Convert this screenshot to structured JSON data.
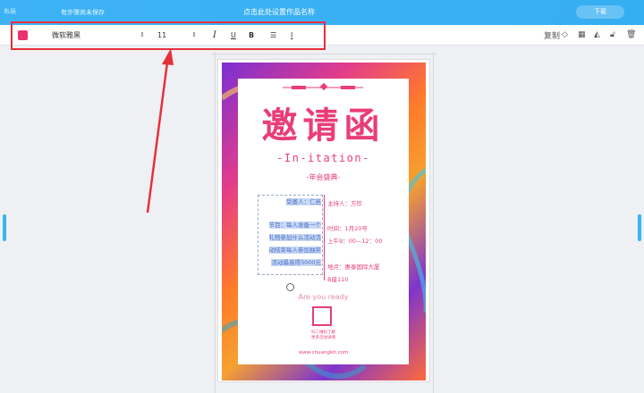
{
  "topbar": {
    "left_text": "布局",
    "save_status": "有步骤尚未保存",
    "title": "点击此处设置作品名称",
    "publish_label": "下载"
  },
  "toolbar": {
    "color_hex": "#e8336e",
    "font_family": "微软雅黑",
    "font_size": "11",
    "italic_label": "I",
    "underline_label": "U",
    "bold_label": "B",
    "copy_label": "复制"
  },
  "poster": {
    "title_cn": "邀请函",
    "title_en": "-In-itation-",
    "subtitle": "-年会盛典-",
    "inviter": "受邀人：仁邑",
    "body_lines": [
      "节目：每人准备一个",
      "礼物参加什么活动活",
      "动结束每人参加抽奖",
      "活动最高得3000元"
    ],
    "host": "主持人：方珍",
    "time_label": "时间：1月20号",
    "time_range": "上午9：00—12：00",
    "place_label": "地点：惠泰国际大厦",
    "place_room": "B座110",
    "ready": "Are you ready",
    "qr_text_1": "扫二维码了解",
    "qr_text_2": "更多活动详情",
    "website": "www.chuangkit.com"
  },
  "colors": {
    "topbar": "#3db3f5",
    "selection_border": "#e8303b",
    "poster_pink": "#e93d78"
  },
  "icons": [
    "align-left-icon",
    "style-icon",
    "layers-icon",
    "transparency-icon",
    "flip-icon",
    "lock-icon",
    "delete-icon"
  ]
}
